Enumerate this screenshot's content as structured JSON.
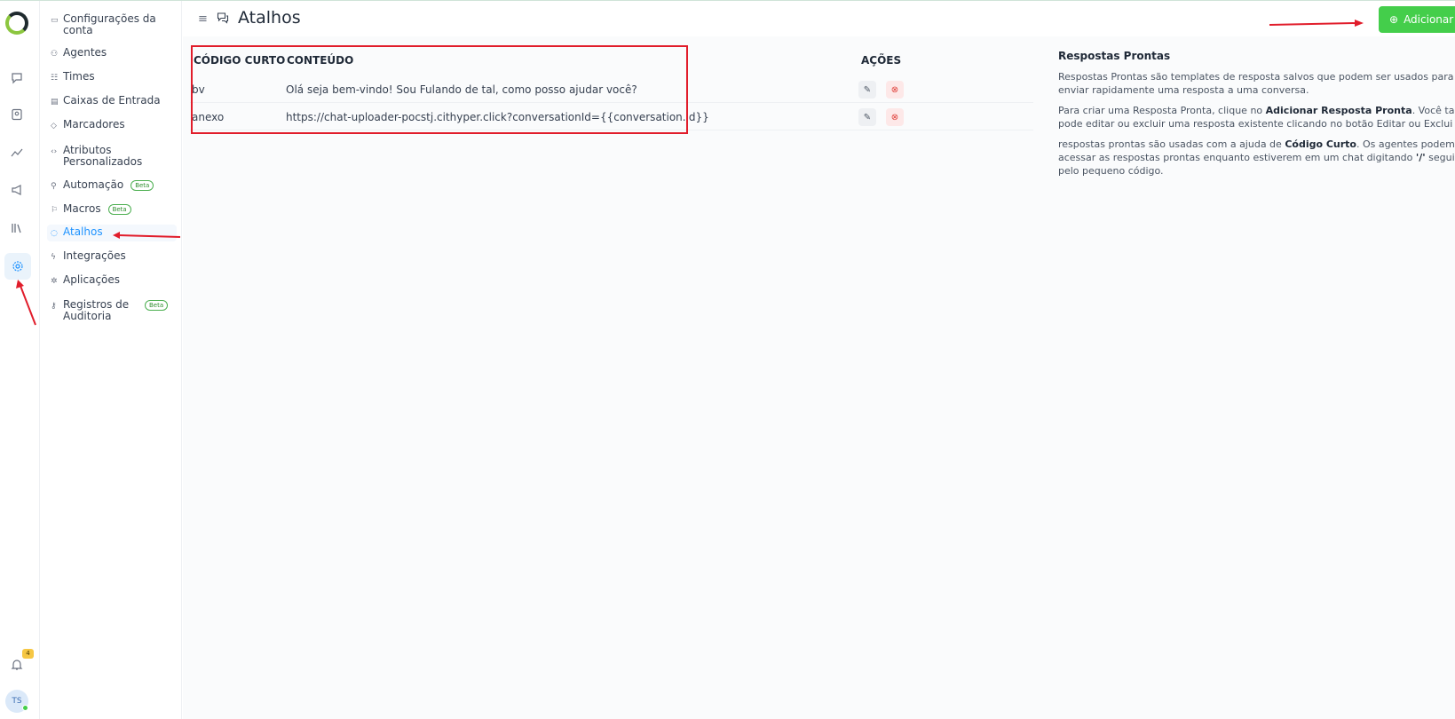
{
  "colors": {
    "accent": "#1f93ff",
    "primary_button": "#44ce4b",
    "annotation": "#e11d2b"
  },
  "rail": {
    "icons": [
      "logo",
      "conversations-icon",
      "contacts-icon",
      "reports-icon",
      "campaigns-icon",
      "library-icon",
      "settings-icon"
    ],
    "notification_count": "4",
    "avatar_initials": "TS"
  },
  "sidebar": {
    "items": [
      {
        "label": "Configurações da conta",
        "icon": "briefcase-icon"
      },
      {
        "label": "Agentes",
        "icon": "people-icon"
      },
      {
        "label": "Times",
        "icon": "team-icon"
      },
      {
        "label": "Caixas de Entrada",
        "icon": "inbox-icon"
      },
      {
        "label": "Marcadores",
        "icon": "tag-icon"
      },
      {
        "label": "Atributos Personalizados",
        "icon": "code-icon"
      },
      {
        "label": "Automação",
        "icon": "automation-icon",
        "badge": "Beta"
      },
      {
        "label": "Macros",
        "icon": "macro-icon",
        "badge": "Beta"
      },
      {
        "label": "Atalhos",
        "icon": "chat-icon"
      },
      {
        "label": "Integrações",
        "icon": "plug-icon"
      },
      {
        "label": "Aplicações",
        "icon": "apps-icon"
      },
      {
        "label": "Registros de Auditoria",
        "icon": "key-icon",
        "badge": "Beta"
      }
    ]
  },
  "header": {
    "title": "Atalhos",
    "add_button_label": "Adicionar"
  },
  "table": {
    "headers": {
      "code": "CÓDIGO CURTO",
      "content": "CONTEÚDO",
      "actions": "AÇÕES"
    },
    "rows": [
      {
        "code": "bv",
        "content": "Olá seja bem-vindo! Sou Fulando de tal, como posso ajudar você?"
      },
      {
        "code": "anexo",
        "content": "https://chat-uploader-pocstj.cithyper.click?conversationId={{conversation.id}}"
      }
    ]
  },
  "info": {
    "title": "Respostas Prontas",
    "p1_line1": "Respostas Prontas são templates de resposta salvos que podem ser usados para",
    "p1_line2": "enviar rapidamente uma resposta a uma conversa.",
    "p2_line1_a": "Para criar uma Resposta Pronta, clique no ",
    "p2_line1_b": "Adicionar Resposta Pronta",
    "p2_line1_c": ". Você tamb",
    "p2_line2": "pode editar ou excluir uma resposta existente clicando no botão Editar ou Exclui",
    "p3_line1_a": "respostas prontas são usadas com a ajuda de ",
    "p3_line1_b": "Código Curto",
    "p3_line1_c": ". Os agentes podem",
    "p3_line2_a": "acessar as respostas prontas enquanto estiverem em um chat digitando ",
    "p3_line2_b": "'/'",
    "p3_line2_c": " segui",
    "p3_line3": "pelo pequeno código."
  }
}
